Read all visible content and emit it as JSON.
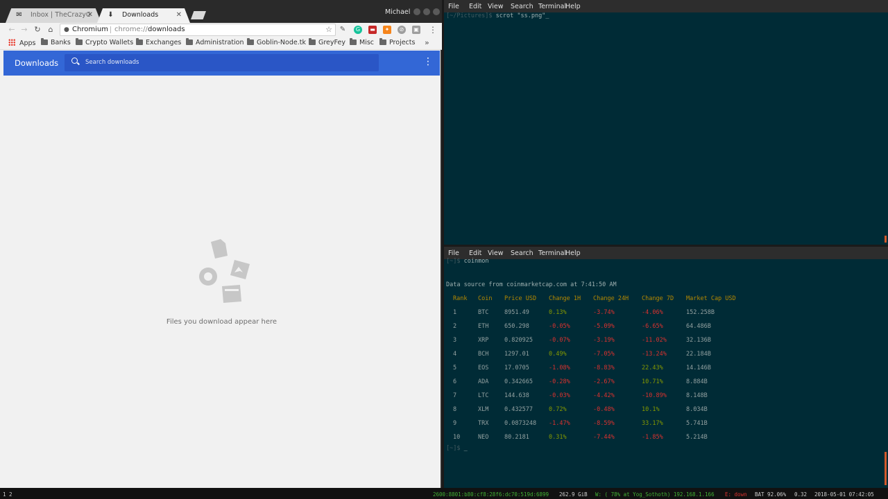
{
  "chrome": {
    "tabs": [
      {
        "label": "Inbox | TheCrazyGM",
        "favicon": "mail-icon"
      },
      {
        "label": "Downloads",
        "favicon": "download-icon"
      }
    ],
    "profile": "Michael",
    "omnibox": {
      "site": "Chromium",
      "scheme": "chrome://",
      "path": "downloads"
    },
    "bookmarks": [
      "Apps",
      "Banks",
      "Crypto Wallets",
      "Exchanges",
      "Administration",
      "Goblin-Node.tk",
      "GreyFey",
      "Misc",
      "Projects"
    ],
    "overflow": "»",
    "downloads_page": {
      "title": "Downloads",
      "search_placeholder": "Search downloads",
      "empty_message": "Files you download appear here"
    }
  },
  "terminal_top": {
    "menu": [
      "File",
      "Edit",
      "View",
      "Search",
      "Terminal",
      "Help"
    ],
    "prompt": "[~/Pictures]$",
    "command": "scrot \"ss.png\"",
    "cursor": "_"
  },
  "terminal_bottom": {
    "menu": [
      "File",
      "Edit",
      "View",
      "Search",
      "Terminal",
      "Help"
    ],
    "prompt1": "[~]$",
    "command1": "coinmon",
    "source_line": "Data source from coinmarketcap.com at 7:41:50 AM",
    "table_headers": [
      "Rank",
      "Coin",
      "Price USD",
      "Change 1H",
      "Change 24H",
      "Change 7D",
      "Market Cap USD"
    ],
    "rows": [
      [
        "1",
        "BTC",
        "8951.49",
        "0.13%",
        "-3.74%",
        "-4.06%",
        "152.258B"
      ],
      [
        "2",
        "ETH",
        "650.298",
        "-0.05%",
        "-5.09%",
        "-6.65%",
        "64.486B"
      ],
      [
        "3",
        "XRP",
        "0.820925",
        "-0.07%",
        "-3.19%",
        "-11.02%",
        "32.136B"
      ],
      [
        "4",
        "BCH",
        "1297.01",
        "0.49%",
        "-7.05%",
        "-13.24%",
        "22.184B"
      ],
      [
        "5",
        "EOS",
        "17.0705",
        "-1.08%",
        "-8.83%",
        "22.43%",
        "14.146B"
      ],
      [
        "6",
        "ADA",
        "0.342665",
        "-0.28%",
        "-2.67%",
        "10.71%",
        "8.884B"
      ],
      [
        "7",
        "LTC",
        "144.638",
        "-0.03%",
        "-4.42%",
        "-10.89%",
        "8.148B"
      ],
      [
        "8",
        "XLM",
        "0.432577",
        "0.72%",
        "-0.48%",
        "10.1%",
        "8.034B"
      ],
      [
        "9",
        "TRX",
        "0.0873248",
        "-1.47%",
        "-8.59%",
        "33.17%",
        "5.741B"
      ],
      [
        "10",
        "NEO",
        "80.2181",
        "0.31%",
        "-7.44%",
        "-1.85%",
        "5.214B"
      ]
    ],
    "prompt2": "[~]$",
    "cursor": "_"
  },
  "statusbar": {
    "workspaces": "1 2",
    "ipv6": "2600:8801:b80:cf8:28f6:dc70:519d:6899",
    "disk": "262.9 GiB",
    "wifi": "W: ( 78% at Yog_Sothoth) 192.168.1.166",
    "eth": "E: down",
    "battery": "BAT 92.06%",
    "load": "0.32",
    "datetime": "2018-05-01 07:42:05"
  },
  "colors": {
    "terminal_bg": "#002b36",
    "positive": "#859900",
    "negative": "#dc322f",
    "header": "#b58900",
    "downloads_header": "#3367d6"
  }
}
